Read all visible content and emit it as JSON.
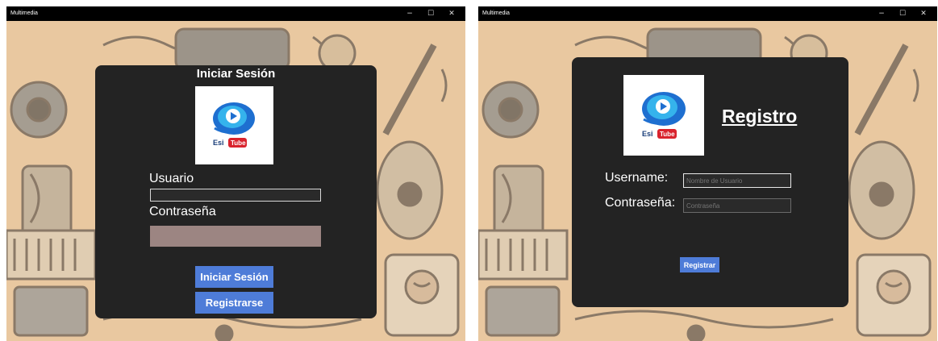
{
  "left_window": {
    "title": "Multimedia",
    "controls": {
      "minimize": "−",
      "maximize": "☐",
      "close": "✕"
    },
    "login": {
      "heading": "Iniciar Sesión",
      "logo_text_1": "Esi",
      "logo_text_2": "Tube",
      "username_label": "Usuario",
      "username_value": "",
      "password_label": "Contraseña",
      "password_value": "",
      "login_button": "Iniciar Sesión",
      "register_button": "Registrarse"
    }
  },
  "right_window": {
    "title": "Multimedia",
    "controls": {
      "minimize": "−",
      "maximize": "☐",
      "close": "✕"
    },
    "register": {
      "heading": "Registro",
      "logo_text_1": "Esi",
      "logo_text_2": "Tube",
      "username_label": "Username:",
      "username_placeholder": "Nombre de Usuario",
      "password_label": "Contraseña:",
      "password_placeholder": "Contraseña",
      "register_button": "Registrar"
    }
  },
  "colors": {
    "panel": "#232323",
    "button": "#4e7cd8",
    "background": "#e8c9a0",
    "password_field_left": "#9c8582"
  }
}
